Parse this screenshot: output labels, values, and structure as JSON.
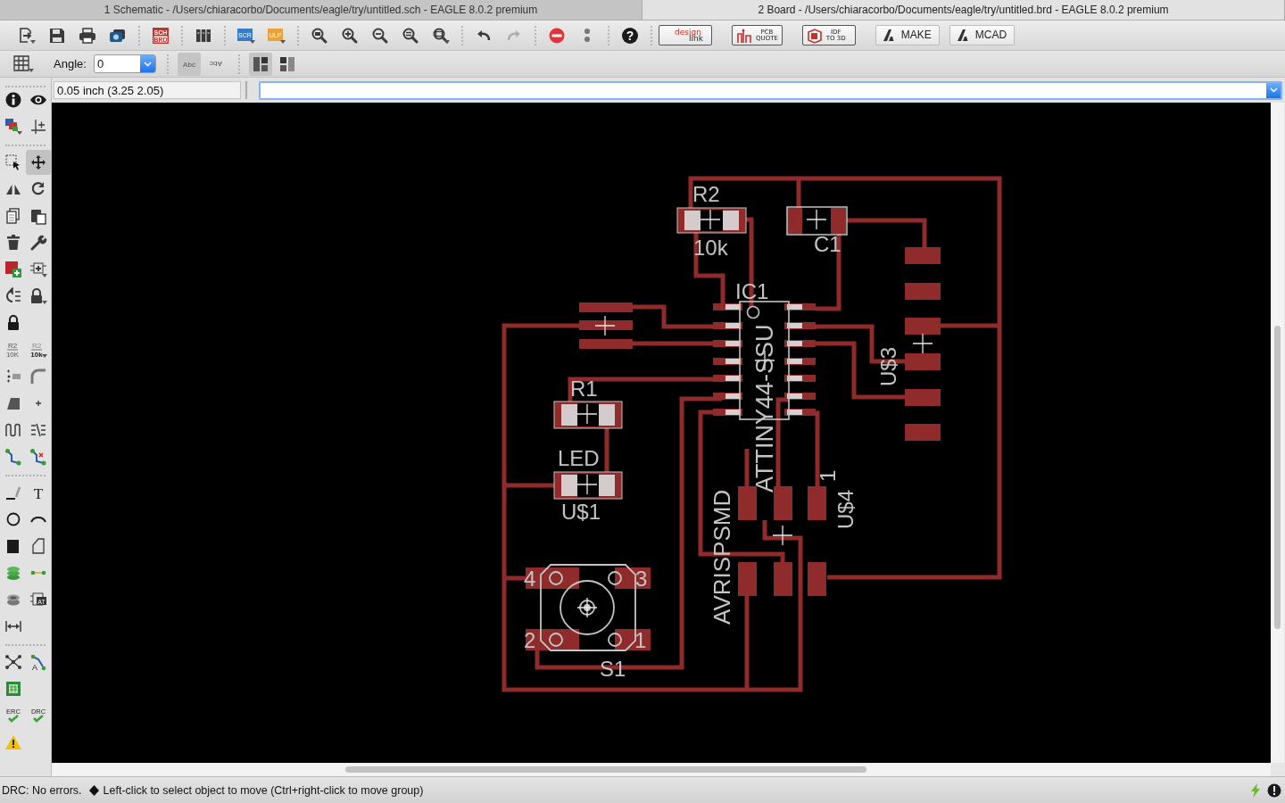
{
  "title_tabs": [
    {
      "label": "1 Schematic - /Users/chiaracorbo/Documents/eagle/try/untitled.sch - EAGLE 8.0.2 premium",
      "selected": false
    },
    {
      "label": "2 Board - /Users/chiaracorbo/Documents/eagle/try/untitled.brd - EAGLE 8.0.2 premium",
      "selected": true
    }
  ],
  "toolbar": {
    "groups": [
      [
        {
          "kind": "open",
          "disabled": false
        },
        {
          "kind": "save",
          "disabled": false
        },
        {
          "kind": "print",
          "disabled": false
        },
        {
          "kind": "cam",
          "disabled": false
        }
      ],
      [
        {
          "kind": "schbrd",
          "lines": [
            "SCH",
            "BRD"
          ],
          "disabled": false
        }
      ],
      [
        {
          "kind": "library",
          "disabled": false
        }
      ],
      [
        {
          "kind": "scr",
          "label": "SCR",
          "disabled": false
        },
        {
          "kind": "ulp",
          "label": "ULP",
          "disabled": false
        }
      ],
      [
        {
          "kind": "zoomfit",
          "disabled": false
        },
        {
          "kind": "zoomin",
          "disabled": false
        },
        {
          "kind": "zoomout",
          "disabled": false
        },
        {
          "kind": "zoomredraw",
          "disabled": false
        },
        {
          "kind": "zoomselect",
          "disabled": false
        }
      ],
      [
        {
          "kind": "undo",
          "disabled": false
        },
        {
          "kind": "redo",
          "disabled": true
        }
      ],
      [
        {
          "kind": "stop",
          "disabled": false
        },
        {
          "kind": "dots",
          "disabled": false
        }
      ],
      [
        {
          "kind": "help",
          "label": "?",
          "disabled": false
        }
      ]
    ],
    "services": [
      {
        "kind": "designlink",
        "lines": [
          "design",
          "link"
        ]
      },
      {
        "kind": "pcbquote",
        "lines": [
          "PCB",
          "QUOTE"
        ]
      },
      {
        "kind": "idf",
        "lines": [
          "IDF",
          "TO 3D"
        ]
      },
      {
        "kind": "fusion",
        "lines": [
          "MAKE"
        ]
      },
      {
        "kind": "fusion",
        "lines": [
          "MCAD"
        ]
      }
    ]
  },
  "options_bar": {
    "angle": {
      "label": "Angle:",
      "value": "0"
    },
    "text_tools": [
      {
        "kind": "abc",
        "label": "Abc",
        "selected": true
      },
      {
        "kind": "abc-flipped",
        "label": "Abc",
        "selected": false
      }
    ],
    "layout_tools": [
      {
        "kind": "pane-a",
        "selected": true
      },
      {
        "kind": "pane-b",
        "selected": false
      }
    ]
  },
  "command_line": {
    "coordinates": "0.05 inch (3.25 2.05)"
  },
  "left_toolbar": [
    [
      [
        {
          "kind": "info",
          "selected": false
        },
        {
          "kind": "eye",
          "selected": false
        }
      ],
      [
        {
          "kind": "layers",
          "selected": false
        },
        {
          "kind": "mark",
          "selected": false
        }
      ]
    ],
    [
      [
        {
          "kind": "group",
          "selected": false
        },
        {
          "kind": "move",
          "selected": true
        }
      ],
      [
        {
          "kind": "mirror",
          "selected": false
        },
        {
          "kind": "rotate",
          "selected": false
        }
      ],
      [
        {
          "kind": "copy",
          "selected": false
        },
        {
          "kind": "paste",
          "selected": false
        }
      ],
      [
        {
          "kind": "delete",
          "selected": false
        },
        {
          "kind": "wrench",
          "selected": false
        }
      ],
      [
        {
          "kind": "add",
          "selected": false
        },
        {
          "kind": "replace",
          "selected": false
        }
      ],
      [
        {
          "kind": "swap",
          "selected": false
        },
        {
          "kind": "lockmenu",
          "selected": false
        }
      ],
      [
        {
          "kind": "lock",
          "selected": false
        }
      ],
      [
        {
          "kind": "name",
          "lines": [
            "R2",
            "10K"
          ],
          "selected": false
        },
        {
          "kind": "value",
          "lines": [
            "R2",
            "10k"
          ],
          "selected": false
        }
      ],
      [
        {
          "kind": "smash",
          "selected": false
        },
        {
          "kind": "miter",
          "selected": false
        }
      ],
      [
        {
          "kind": "split",
          "selected": false
        },
        {
          "kind": "junction",
          "selected": false
        }
      ],
      [
        {
          "kind": "meander",
          "selected": false
        },
        {
          "kind": "optimize",
          "selected": false
        }
      ],
      [
        {
          "kind": "route",
          "selected": false
        },
        {
          "kind": "ripup",
          "selected": false
        }
      ]
    ],
    [
      [
        {
          "kind": "line",
          "selected": false
        },
        {
          "kind": "text",
          "label": "T",
          "selected": false
        }
      ],
      [
        {
          "kind": "circle",
          "selected": false
        },
        {
          "kind": "arc",
          "selected": false
        }
      ],
      [
        {
          "kind": "rect",
          "selected": false
        },
        {
          "kind": "polygon",
          "selected": false
        }
      ],
      [
        {
          "kind": "via",
          "selected": false
        },
        {
          "kind": "signal",
          "selected": false
        }
      ],
      [
        {
          "kind": "hole",
          "selected": false
        },
        {
          "kind": "attribute",
          "label": "AT",
          "selected": false
        }
      ],
      [
        {
          "kind": "dimension",
          "selected": false
        }
      ]
    ],
    [
      [
        {
          "kind": "ratsnest",
          "selected": false
        },
        {
          "kind": "autorouter",
          "label": "A",
          "selected": false
        }
      ],
      [
        {
          "kind": "board",
          "selected": false
        }
      ],
      [
        {
          "kind": "erc",
          "label": "ERC",
          "selected": false
        },
        {
          "kind": "drc",
          "label": "DRC",
          "selected": false
        }
      ],
      [
        {
          "kind": "warning",
          "selected": false
        }
      ]
    ]
  ],
  "board": {
    "parts": [
      {
        "name": "R2",
        "value": "10k"
      },
      {
        "name": "C1"
      },
      {
        "name": "IC1",
        "value": "ATTINY44-SSU"
      },
      {
        "name": "R1"
      },
      {
        "name": "U$1",
        "value": "LED"
      },
      {
        "name": "S1",
        "pins": [
          "4",
          "3",
          "2",
          "1"
        ]
      },
      {
        "name": "U$4",
        "value": "AVRISPSMD",
        "pins": [
          "1"
        ]
      },
      {
        "name": "U$3"
      }
    ]
  },
  "status_bar": {
    "message": "DRC: No errors.",
    "hint": "Left-click to select object to move (Ctrl+right-click to move group)"
  }
}
